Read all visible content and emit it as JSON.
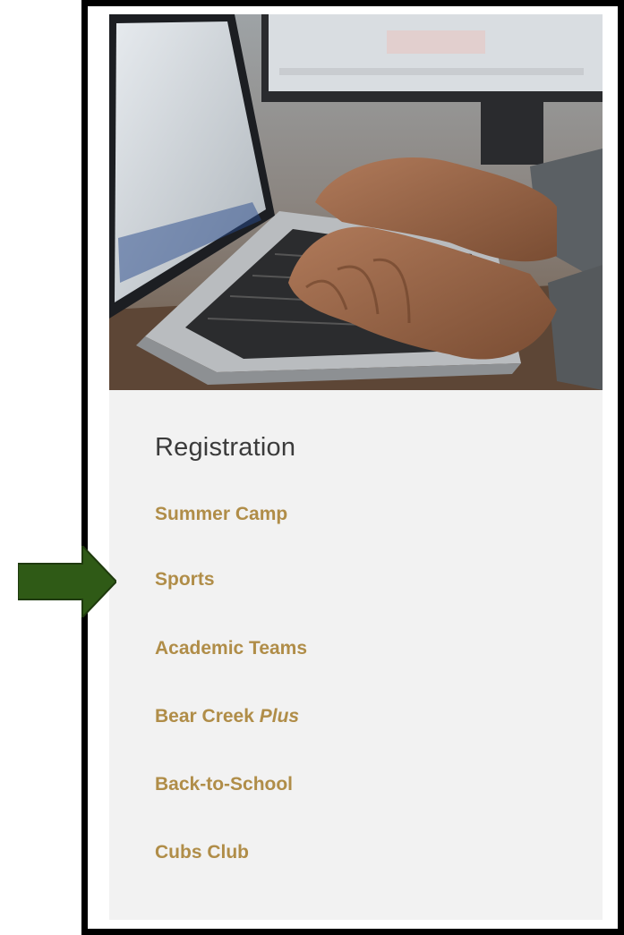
{
  "nav": {
    "title": "Registration",
    "items": [
      {
        "label": "Summer Camp"
      },
      {
        "label": "Sports"
      },
      {
        "label": "Academic Teams"
      },
      {
        "label": "Bear Creek ",
        "suffix": "Plus"
      },
      {
        "label": "Back-to-School"
      },
      {
        "label": "Cubs Club"
      }
    ]
  },
  "colors": {
    "link": "#b08d48",
    "title": "#3b3b3b",
    "panel": "#f2f2f2",
    "arrow": "#2f5a16",
    "frame": "#000000"
  },
  "annotation": {
    "icon": "arrow-right-icon",
    "points_to": "Sports"
  },
  "hero": {
    "subject": "hands typing on a laptop keyboard"
  }
}
